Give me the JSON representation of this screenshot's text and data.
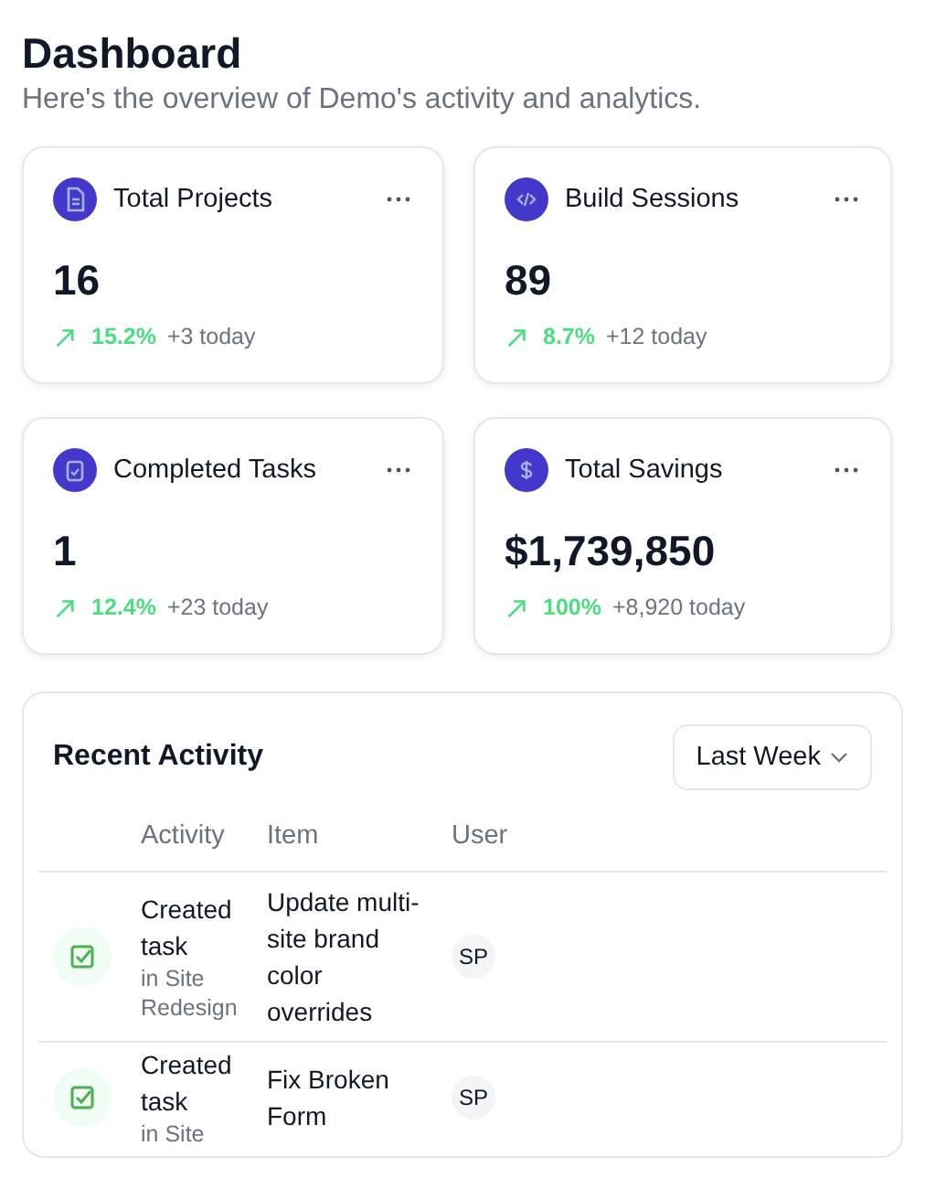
{
  "header": {
    "title": "Dashboard",
    "subtitle": "Here's the overview of Demo's activity and analytics."
  },
  "stats": [
    {
      "kind": "document",
      "label": "Total Projects",
      "value": "16",
      "rising": true,
      "change": "15.2%",
      "today": "+3 today"
    },
    {
      "kind": "code",
      "label": "Build Sessions",
      "value": "89",
      "rising": true,
      "change": "8.7%",
      "today": "+12 today"
    },
    {
      "kind": "clipboard",
      "label": "Completed Tasks",
      "value": "1",
      "rising": true,
      "change": "12.4%",
      "today": "+23 today"
    },
    {
      "kind": "dollar",
      "label": "Total Savings",
      "value": "$1,739,850",
      "rising": true,
      "change": "100%",
      "today": "+8,920 today"
    }
  ],
  "activity": {
    "title": "Recent Activity",
    "period": "Last Week",
    "columns": [
      "Activity",
      "Item",
      "User"
    ],
    "rows": [
      {
        "kind": "task",
        "action": "Created task",
        "context": "in Site Redesign",
        "item": "Update multi-site brand color overrides",
        "user": "SP"
      },
      {
        "kind": "task",
        "action": "Created task",
        "context": "in Site",
        "item": "Fix Broken Form",
        "user": "SP"
      }
    ]
  }
}
